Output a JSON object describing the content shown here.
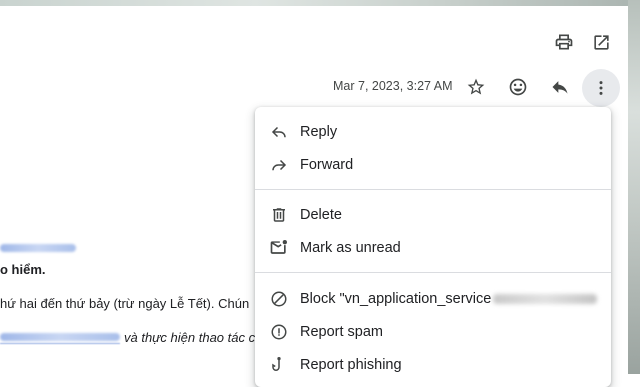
{
  "header": {
    "date": "Mar 7, 2023, 3:27 AM",
    "icons": [
      "print-icon",
      "open-in-new-window-icon",
      "star-icon",
      "emoji-icon",
      "reply-icon",
      "more-vert-icon"
    ]
  },
  "email_body": {
    "line_bold": "o hiểm.",
    "line_1": "hứ hai đến thứ bảy (trừ ngày Lễ Tết). Chún",
    "line_2_suffix": "và thực hiện thao tác c"
  },
  "menu": {
    "items": [
      {
        "label": "Reply",
        "icon": "reply-icon"
      },
      {
        "label": "Forward",
        "icon": "forward-icon"
      },
      {
        "label": "Delete",
        "icon": "trash-icon"
      },
      {
        "label": "Mark as unread",
        "icon": "mark-unread-icon"
      },
      {
        "label": "Block \"vn_application_service",
        "icon": "block-icon"
      },
      {
        "label": "Report spam",
        "icon": "report-spam-icon"
      },
      {
        "label": "Report phishing",
        "icon": "phishing-hook-icon"
      }
    ]
  },
  "colors": {
    "icon": "#444746",
    "text": "#202124",
    "link": "#1a73e8",
    "separator": "#dadce0"
  }
}
